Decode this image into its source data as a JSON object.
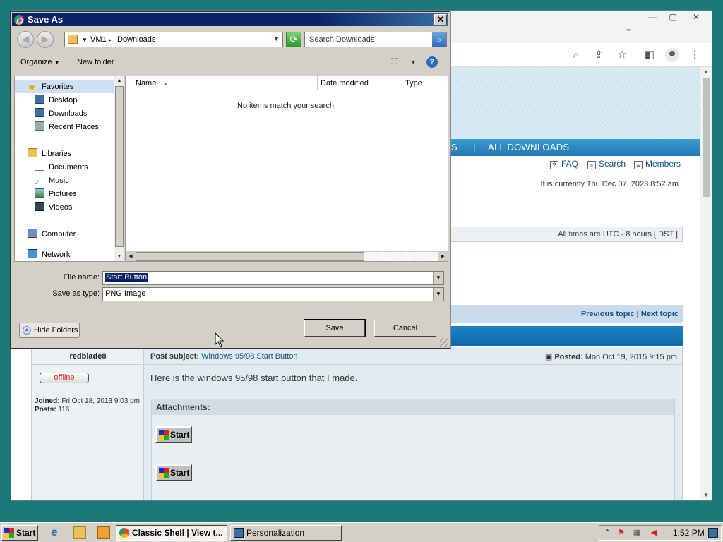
{
  "browser": {
    "toolbar_icons": [
      "search-icon",
      "share-icon",
      "star-icon",
      "sidebar-icon",
      "profile-icon",
      "menu-icon"
    ],
    "nav": {
      "sep": "S",
      "pipe": "|",
      "all_downloads": "ALL DOWNLOADS"
    },
    "toplinks": {
      "faq": "FAQ",
      "search": "Search",
      "members": "Members"
    },
    "current_time": "It is currently Thu Dec 07, 2023 8:52 am",
    "timezone": "All times are UTC - 8 hours [ DST ]",
    "topic_nav": {
      "previous": "Previous topic",
      "sep": "|",
      "next": "Next topic"
    },
    "post": {
      "author": "redblade8",
      "status": "offline",
      "joined_label": "Joined:",
      "joined_value": "Fri Oct 18, 2013 9:03 pm",
      "posts_label": "Posts:",
      "posts_value": "116",
      "subject_label": "Post subject:",
      "subject_value": "Windows 95/98 Start Button",
      "posted_label": "Posted:",
      "posted_value": "Mon Oct 19, 2015 9:15 pm",
      "text": "Here is the windows 95/98 start button that I made.",
      "attachments_label": "Attachments:",
      "attachment_button_label": "Start"
    }
  },
  "dialog": {
    "title": "Save As",
    "path": {
      "root": "VM1",
      "sep": "▸",
      "folder": "Downloads"
    },
    "search_placeholder": "Search Downloads",
    "organize_label": "Organize",
    "new_folder_label": "New folder",
    "nav_items": {
      "favorites": "Favorites",
      "desktop": "Desktop",
      "downloads": "Downloads",
      "recent": "Recent Places",
      "libraries": "Libraries",
      "documents": "Documents",
      "music": "Music",
      "pictures": "Pictures",
      "videos": "Videos",
      "computer": "Computer",
      "network": "Network"
    },
    "columns": {
      "name": "Name",
      "date": "Date modified",
      "type": "Type"
    },
    "empty_message": "No items match your search.",
    "file_name_label": "File name:",
    "file_name_value": "Start Button",
    "save_type_label": "Save as type:",
    "save_type_value": "PNG Image",
    "hide_folders_label": "Hide Folders",
    "save_label": "Save",
    "cancel_label": "Cancel"
  },
  "taskbar": {
    "start_label": "Start",
    "tasks": [
      {
        "label": "Classic Shell | View t...",
        "active": true
      },
      {
        "label": "Personalization",
        "active": false
      }
    ],
    "clock": "1:52 PM"
  },
  "colors": {
    "desktop": "#1a7a7a",
    "dialog_title": "#0a246a",
    "link": "#105289",
    "nav_blue": "#1f78b4"
  }
}
